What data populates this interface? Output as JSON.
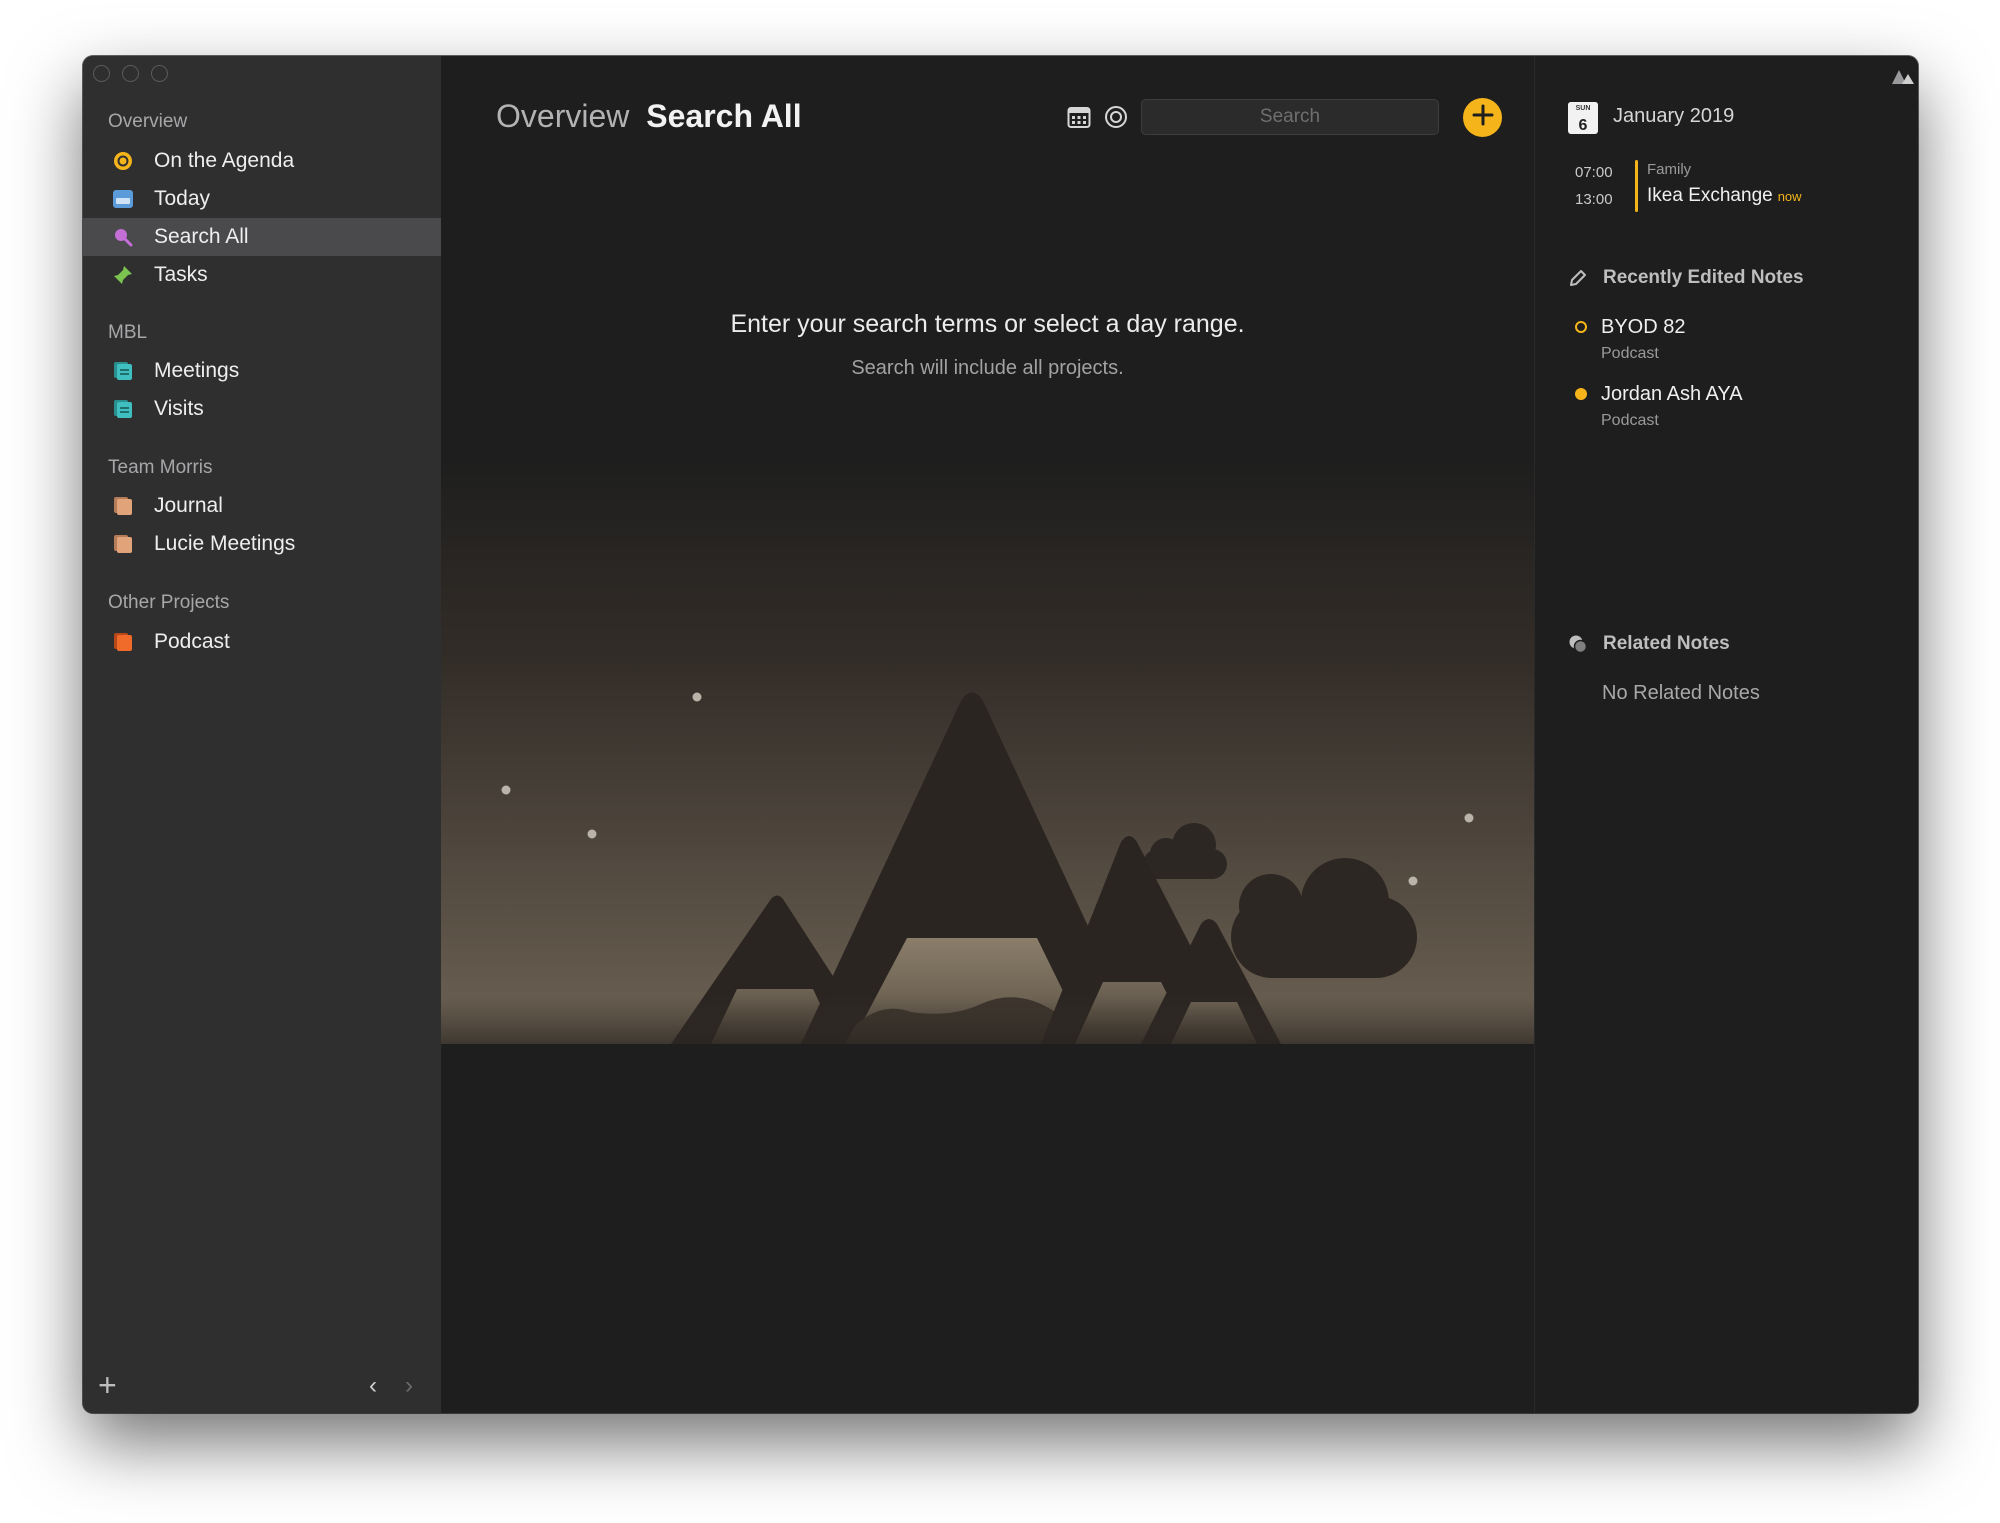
{
  "sidebar": {
    "sections": [
      {
        "label": "Overview",
        "items": [
          {
            "label": "On the Agenda",
            "icon": "agenda-icon",
            "color": "#f5b51a"
          },
          {
            "label": "Today",
            "icon": "today-icon",
            "color": "#5b9bd9"
          },
          {
            "label": "Search All",
            "icon": "search-icon",
            "color": "#c46fd6",
            "selected": true
          },
          {
            "label": "Tasks",
            "icon": "pin-icon",
            "color": "#7bc24f"
          }
        ]
      },
      {
        "label": "MBL",
        "items": [
          {
            "label": "Meetings",
            "icon": "notebook-icon",
            "color": "#3fbfbf"
          },
          {
            "label": "Visits",
            "icon": "notebook-icon",
            "color": "#3fbfbf"
          }
        ]
      },
      {
        "label": "Team Morris",
        "items": [
          {
            "label": "Journal",
            "icon": "notebook-icon",
            "color": "#e1a47a"
          },
          {
            "label": "Lucie Meetings",
            "icon": "notebook-icon",
            "color": "#e1a47a"
          }
        ]
      },
      {
        "label": "Other Projects",
        "items": [
          {
            "label": "Podcast",
            "icon": "notebook-icon",
            "color": "#f06a2a"
          }
        ]
      }
    ],
    "footer": {
      "add": "+",
      "back": "‹",
      "forward": "›"
    }
  },
  "header": {
    "parent": "Overview",
    "current": "Search All",
    "search_placeholder": "Search",
    "search_value": ""
  },
  "empty_state": {
    "title": "Enter your search terms or select a day range.",
    "subtitle": "Search will include all projects."
  },
  "agenda": {
    "calendar_day_short": "SUN",
    "calendar_day_num": "6",
    "month": "January 2019",
    "event": {
      "start": "07:00",
      "end": "13:00",
      "calendar": "Family",
      "title": "Ikea Exchange",
      "badge": "now"
    }
  },
  "recent_notes": {
    "heading": "Recently Edited Notes",
    "items": [
      {
        "title": "BYOD 82",
        "project": "Podcast",
        "dot": "hollow",
        "color": "#f5b51a"
      },
      {
        "title": "Jordan Ash AYA",
        "project": "Podcast",
        "dot": "filled",
        "color": "#f5b51a"
      }
    ]
  },
  "related_notes": {
    "heading": "Related Notes",
    "empty": "No Related Notes"
  },
  "colors": {
    "accent": "#f5b51a",
    "sidebar_bg": "#2f2f30",
    "main_bg": "#1e1e1e"
  }
}
